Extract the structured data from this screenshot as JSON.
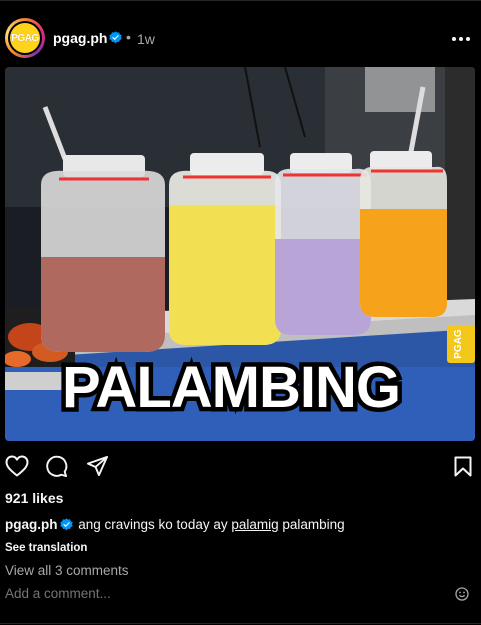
{
  "post": {
    "username": "pgag.ph",
    "time_sep": "•",
    "time": "1w",
    "avatar_text": "PGAG"
  },
  "image": {
    "overlay_text": "PALAMBING",
    "watermark": "PGAG",
    "jug_colors": [
      "#b0695f",
      "#f3df52",
      "#b8a4d6",
      "#f6a21a"
    ]
  },
  "stats": {
    "likes": "921 likes"
  },
  "caption": {
    "username": "pgag.ph",
    "text_before": " ang cravings ko today ay ",
    "link_text": "palamig",
    "text_after": " palambing"
  },
  "see_translation": "See translation",
  "view_comments": "View all 3 comments",
  "add_comment_placeholder": "Add a comment...",
  "colors": {
    "verified": "#0095f6",
    "background": "#000000",
    "secondary_text": "#a8a8a8"
  },
  "icons": [
    "heart-icon",
    "comment-icon",
    "share-icon",
    "bookmark-icon",
    "more-icon",
    "emoji-icon",
    "verified-badge-icon"
  ]
}
